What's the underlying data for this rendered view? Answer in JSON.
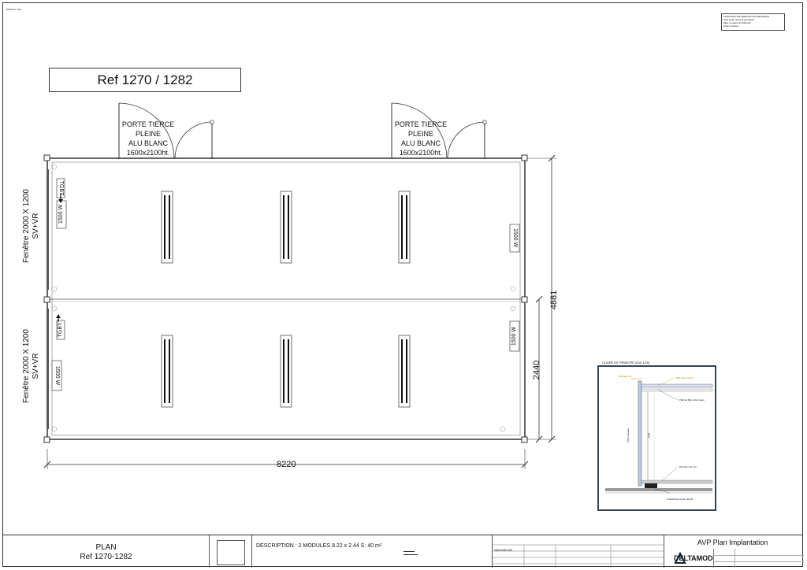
{
  "header": {
    "top_left_small": "BRMALE 1/50"
  },
  "legend": {
    "title": "LIMITATION DE PRESTATION DELTAMOD",
    "lines": [
      "Sont inclus dans la prestation :",
      "Mise en place du bâtiment",
      "Cales d'assise",
      "Module d'aggrégation du module réel"
    ]
  },
  "ref_box": "Ref 1270 / 1282",
  "doors": [
    {
      "lines": [
        "PORTE TIERCE",
        "PLEINE",
        "ALU BLANC",
        "1600x2100ht."
      ]
    },
    {
      "lines": [
        "PORTE TIERCE",
        "PLEINE",
        "ALU BLANC",
        "1600x2100ht."
      ]
    }
  ],
  "windows": [
    {
      "lines": [
        "Fenêtre 2000 X 1200",
        "SV+VR"
      ]
    },
    {
      "lines": [
        "Fenêtre 2000 X 1200",
        "SV+VR"
      ]
    }
  ],
  "heaters": {
    "top_left": "1500 W",
    "top_right": "1500 W",
    "bottom_right": "1500 W",
    "bottom_left": "1500 W"
  },
  "panels": {
    "top": "TGBT",
    "bottom": "TGBT"
  },
  "dimensions": {
    "length": "8220",
    "total_width": "4881",
    "module_width": "2440"
  },
  "section": {
    "title": "COUPE DE PRINCIPE (Ech 1/20)",
    "labels": [
      "Bardage Alu",
      "Bac acier toiture",
      "Plafond Bac Acier laqué",
      "Plancher 20 mm",
      "Calles/Plots béton 40x40",
      "2700 Hauteur",
      "2500"
    ]
  },
  "title_block": {
    "plan_title": "PLAN",
    "plan_ref": "Ref 1270-1282",
    "description": "DESCRIPTION : 2 MODULES  8.22 x 2.44   S: 40 m²",
    "validation": "VALIDATION",
    "project": "AVP Plan Implantation",
    "company": "DELTAMOD"
  }
}
